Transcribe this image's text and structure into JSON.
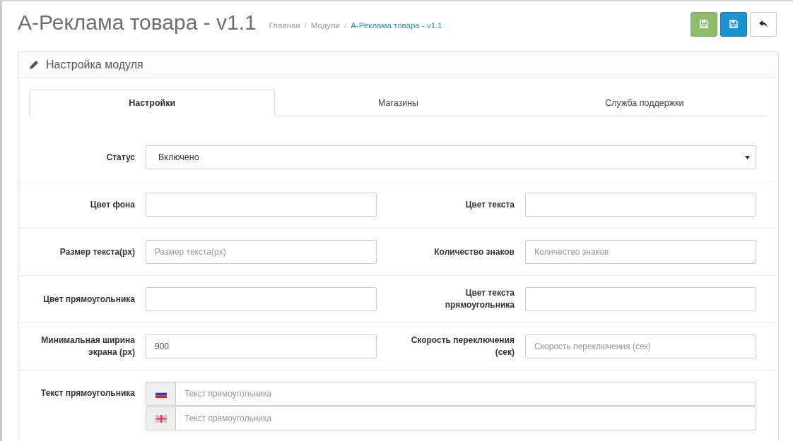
{
  "header": {
    "title": "A-Реклама товара - v1.1",
    "separator": "/",
    "breadcrumbs": [
      {
        "label": "Главная",
        "current": false
      },
      {
        "label": "Модули",
        "current": false
      },
      {
        "label": "A-Реклама товара - v1.1",
        "current": true
      }
    ]
  },
  "toolbar": [
    {
      "kind": "save"
    },
    {
      "kind": "save"
    },
    {
      "kind": "back"
    }
  ],
  "panel": {
    "title": "Настройка модуля",
    "tabs": [
      {
        "label": "Настройки",
        "selected": true
      },
      {
        "label": "Магазины",
        "selected": false
      },
      {
        "label": "Служба поддержки",
        "selected": false
      }
    ],
    "rows": [
      {
        "fields": [
          {
            "label": "Статус",
            "kind": "select",
            "value": "Включено"
          }
        ]
      },
      {
        "fields": [
          {
            "label": "Цвет фона",
            "kind": "text"
          },
          {
            "label": "Цвет текста",
            "kind": "text"
          }
        ]
      },
      {
        "fields": [
          {
            "label": "Размер текста(px)",
            "kind": "text",
            "placeholder": "Размер текста(px)"
          },
          {
            "label": "Количество знаков",
            "kind": "text",
            "placeholder": "Количество знаков"
          }
        ]
      },
      {
        "fields": [
          {
            "label": "Цвет прямоугольника",
            "kind": "text"
          },
          {
            "label": "Цвет текста прямоугольника",
            "kind": "text"
          }
        ]
      },
      {
        "fields": [
          {
            "label": "Минимальная ширина экрана (px)",
            "kind": "text",
            "value": "900"
          },
          {
            "label": "Скорость переключения (сек)",
            "kind": "text",
            "placeholder": "Скорость переключения (сек)"
          }
        ]
      },
      {
        "fields": [
          {
            "label": "Текст прямоугольника",
            "kind": "multilang",
            "languages": [
              {
                "placeholder": "Текст прямоугольника"
              },
              {
                "placeholder": "Текст прямоугольника"
              }
            ]
          }
        ]
      }
    ]
  }
}
